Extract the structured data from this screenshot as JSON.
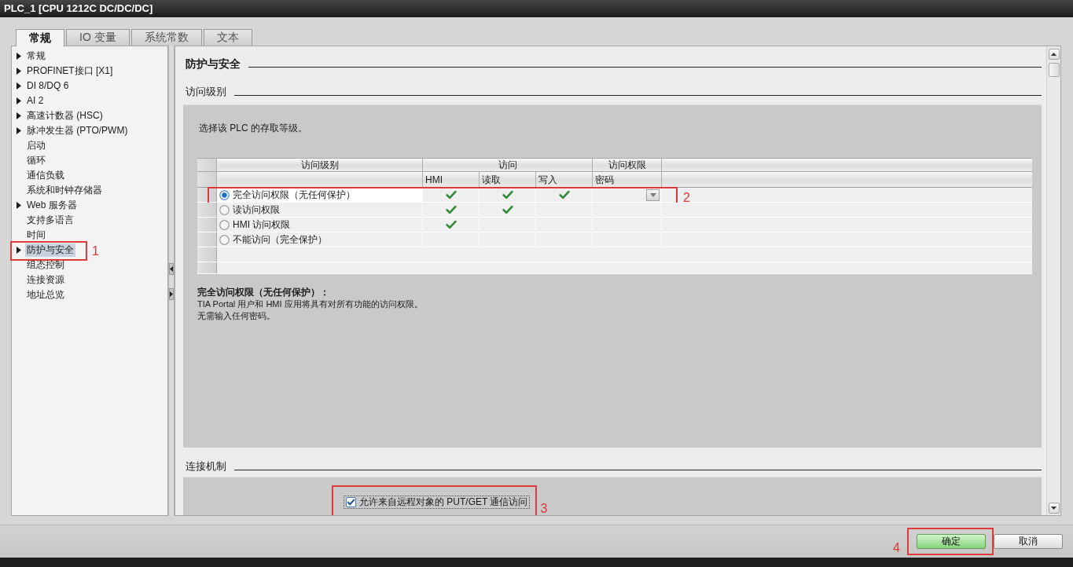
{
  "window": {
    "title": "PLC_1 [CPU 1212C DC/DC/DC]"
  },
  "tabs": [
    {
      "label": "常规",
      "selected": true
    },
    {
      "label": "IO 变量",
      "selected": false
    },
    {
      "label": "系统常数",
      "selected": false
    },
    {
      "label": "文本",
      "selected": false
    }
  ],
  "sidebar": {
    "items": [
      {
        "label": "常规",
        "expandable": true,
        "selected": false
      },
      {
        "label": "PROFINET接口 [X1]",
        "expandable": true,
        "selected": false
      },
      {
        "label": "DI 8/DQ 6",
        "expandable": true,
        "selected": false
      },
      {
        "label": "AI 2",
        "expandable": true,
        "selected": false
      },
      {
        "label": "高速计数器 (HSC)",
        "expandable": true,
        "selected": false
      },
      {
        "label": "脉冲发生器 (PTO/PWM)",
        "expandable": true,
        "selected": false
      },
      {
        "label": "启动",
        "expandable": false,
        "selected": false
      },
      {
        "label": "循环",
        "expandable": false,
        "selected": false
      },
      {
        "label": "通信负载",
        "expandable": false,
        "selected": false
      },
      {
        "label": "系统和时钟存储器",
        "expandable": false,
        "selected": false
      },
      {
        "label": "Web 服务器",
        "expandable": true,
        "selected": false
      },
      {
        "label": "支持多语言",
        "expandable": false,
        "selected": false
      },
      {
        "label": "时间",
        "expandable": false,
        "selected": false
      },
      {
        "label": "防护与安全",
        "expandable": true,
        "selected": true,
        "callout": "1"
      },
      {
        "label": "组态控制",
        "expandable": false,
        "selected": false
      },
      {
        "label": "连接资源",
        "expandable": false,
        "selected": false
      },
      {
        "label": "地址总览",
        "expandable": false,
        "selected": false
      }
    ]
  },
  "content": {
    "title": "防护与安全",
    "access_level": {
      "title": "访问级别",
      "intro": "选择该 PLC 的存取等级。",
      "table": {
        "header_groups": [
          "访问级别",
          "访问",
          "访问权限"
        ],
        "columns": [
          "HMI",
          "读取",
          "写入",
          "密码"
        ],
        "rows": [
          {
            "label": "完全访问权限（无任何保护）",
            "selected": true,
            "hmi": true,
            "read": true,
            "write": true,
            "callout": "2"
          },
          {
            "label": "读访问权限",
            "selected": false,
            "hmi": true,
            "read": true,
            "write": false
          },
          {
            "label": "HMI 访问权限",
            "selected": false,
            "hmi": true,
            "read": false,
            "write": false
          },
          {
            "label": "不能访问（完全保护）",
            "selected": false,
            "hmi": false,
            "read": false,
            "write": false
          }
        ]
      },
      "description": {
        "title": "完全访问权限（无任何保护）：",
        "lines": [
          "TIA Portal 用户和 HMI 应用将具有对所有功能的访问权限。",
          "无需输入任何密码。"
        ]
      }
    },
    "connection": {
      "title": "连接机制",
      "option": {
        "label": "允许来自远程对象的 PUT/GET 通信访问",
        "checked": true,
        "callout": "3"
      }
    }
  },
  "buttons": [
    {
      "label": "确定",
      "kind": "primary",
      "callout": "4"
    },
    {
      "label": "取消",
      "kind": "secondary"
    }
  ]
}
